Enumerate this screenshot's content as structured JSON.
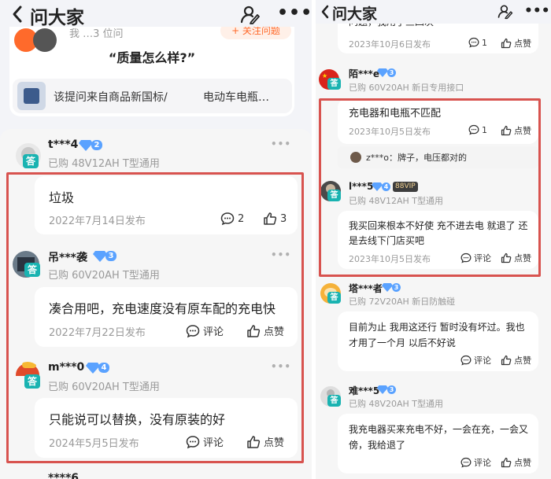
{
  "header": {
    "title": "问大家"
  },
  "left": {
    "top_card": {
      "partial_text": "我  …3 位问",
      "question": "“质量怎么样?”",
      "source_label": "该提问来自商品新国标/",
      "source_product": "电动车电瓶…",
      "follow_button": "+ 关注问题"
    },
    "answers": [
      {
        "user": "t***4",
        "level": "2",
        "bought": "已购 48V12AH  T型通用",
        "text": "垃圾",
        "date": "2022年7月14日发布",
        "comment": "2",
        "like": "3"
      },
      {
        "user": "吊***袭",
        "level": "3",
        "bought": "已购 60V20AH  T型通用",
        "text": "凑合用吧，充电速度没有原车配的充电快",
        "date": "2022年7月22日发布",
        "comment": "评论",
        "like": "点赞"
      },
      {
        "user": "m***0",
        "level": "4",
        "bought": "已购 60V20AH  T型通用",
        "text": "只能说可以替换，没有原装的好",
        "date": "2024年5月5日发布",
        "comment": "评论",
        "like": "点赞"
      },
      {
        "user": "****6"
      }
    ]
  },
  "right": {
    "top_partial": {
      "text": "问题，我用了三四次",
      "date": "2023年10月6日发布",
      "comment": "1",
      "like": "点赞"
    },
    "answers": [
      {
        "user": "陌***e",
        "level": "3",
        "bought": "已购 60V20AH 新日专用接口",
        "text": "充电器和电瓶不匹配",
        "date": "2023年10月5日发布",
        "comment": "1",
        "like": "点赞",
        "reply": {
          "user": "z***o",
          "text": "牌子，电压都对的"
        }
      },
      {
        "user": "l***5",
        "level": "4",
        "vip": "88VIP",
        "bought": "已购 48V12AH  T型通用",
        "text": "我买回来根本不好使  充不进去电   就退了  还是去线下门店买吧",
        "date": "2023年10月5日发布",
        "comment": "评论",
        "like": "点赞"
      },
      {
        "user": "塔***者",
        "level": "3",
        "bought": "已购 72V20AH 新日防触碰",
        "text": "目前为止 我用这还行 暂时没有坏过。我也才用了一个月 以后不好说",
        "date": "",
        "comment": "评论",
        "like": "点赞"
      },
      {
        "user": "难***5",
        "level": "3",
        "bought": "已购 48V20AH  T型通用",
        "text": "我充电器买来充电不好，一会在充，一会又傍，我给退了",
        "date": "",
        "comment": "评论",
        "like": "点赞"
      }
    ]
  },
  "answer_badge": "答",
  "colors": {
    "accent": "#19b3b1",
    "highlight": "#d8534f",
    "gem": "#5aa2ff",
    "orange": "#ff6a2b"
  }
}
